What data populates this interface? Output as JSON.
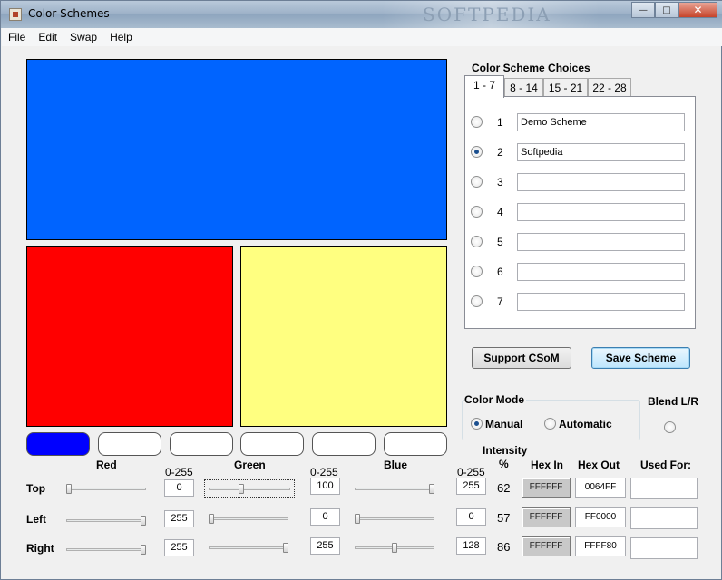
{
  "window": {
    "title": "Color Schemes",
    "watermark": "SOFTPEDIA",
    "controls": {
      "minimize": "—",
      "maximize": "□",
      "close": "✕"
    }
  },
  "menu": [
    "File",
    "Edit",
    "Swap",
    "Help"
  ],
  "preview": {
    "top_color": "#0064FF",
    "left_color": "#FF0000",
    "right_color": "#FFFF80",
    "swatch_selected_color": "#0000FF"
  },
  "channels": {
    "red_label": "Red",
    "green_label": "Green",
    "blue_label": "Blue",
    "range_label": "0-255",
    "intensity_label": "Intensity",
    "percent_label": "%"
  },
  "rows": [
    {
      "label": "Top",
      "red": "0",
      "green": "100",
      "blue": "255",
      "red_frac": 0.0,
      "green_frac": 0.39,
      "blue_frac": 1.0,
      "intensity": "62",
      "hex_in": "FFFFFF",
      "hex_out": "0064FF"
    },
    {
      "label": "Left",
      "red": "255",
      "green": "0",
      "blue": "0",
      "red_frac": 1.0,
      "green_frac": 0.0,
      "blue_frac": 0.0,
      "intensity": "57",
      "hex_in": "FFFFFF",
      "hex_out": "FF0000"
    },
    {
      "label": "Right",
      "red": "255",
      "green": "255",
      "blue": "128",
      "red_frac": 1.0,
      "green_frac": 1.0,
      "blue_frac": 0.5,
      "intensity": "86",
      "hex_in": "FFFFFF",
      "hex_out": "FFFF80"
    }
  ],
  "hex_headers": {
    "hex_in": "Hex  In",
    "hex_out": "Hex  Out",
    "used_for": "Used For:"
  },
  "schemes": {
    "heading": "Color Scheme Choices",
    "tabs": [
      "1 - 7",
      "8 - 14",
      "15 - 21",
      "22 - 28"
    ],
    "items": [
      {
        "num": "1",
        "name": "Demo Scheme",
        "checked": false
      },
      {
        "num": "2",
        "name": "Softpedia",
        "checked": true
      },
      {
        "num": "3",
        "name": "",
        "checked": false
      },
      {
        "num": "4",
        "name": "",
        "checked": false
      },
      {
        "num": "5",
        "name": "",
        "checked": false
      },
      {
        "num": "6",
        "name": "",
        "checked": false
      },
      {
        "num": "7",
        "name": "",
        "checked": false
      }
    ]
  },
  "buttons": {
    "support": "Support CSoM",
    "save": "Save Scheme"
  },
  "color_mode": {
    "heading": "Color Mode",
    "manual": "Manual",
    "automatic": "Automatic",
    "blend": "Blend L/R"
  }
}
